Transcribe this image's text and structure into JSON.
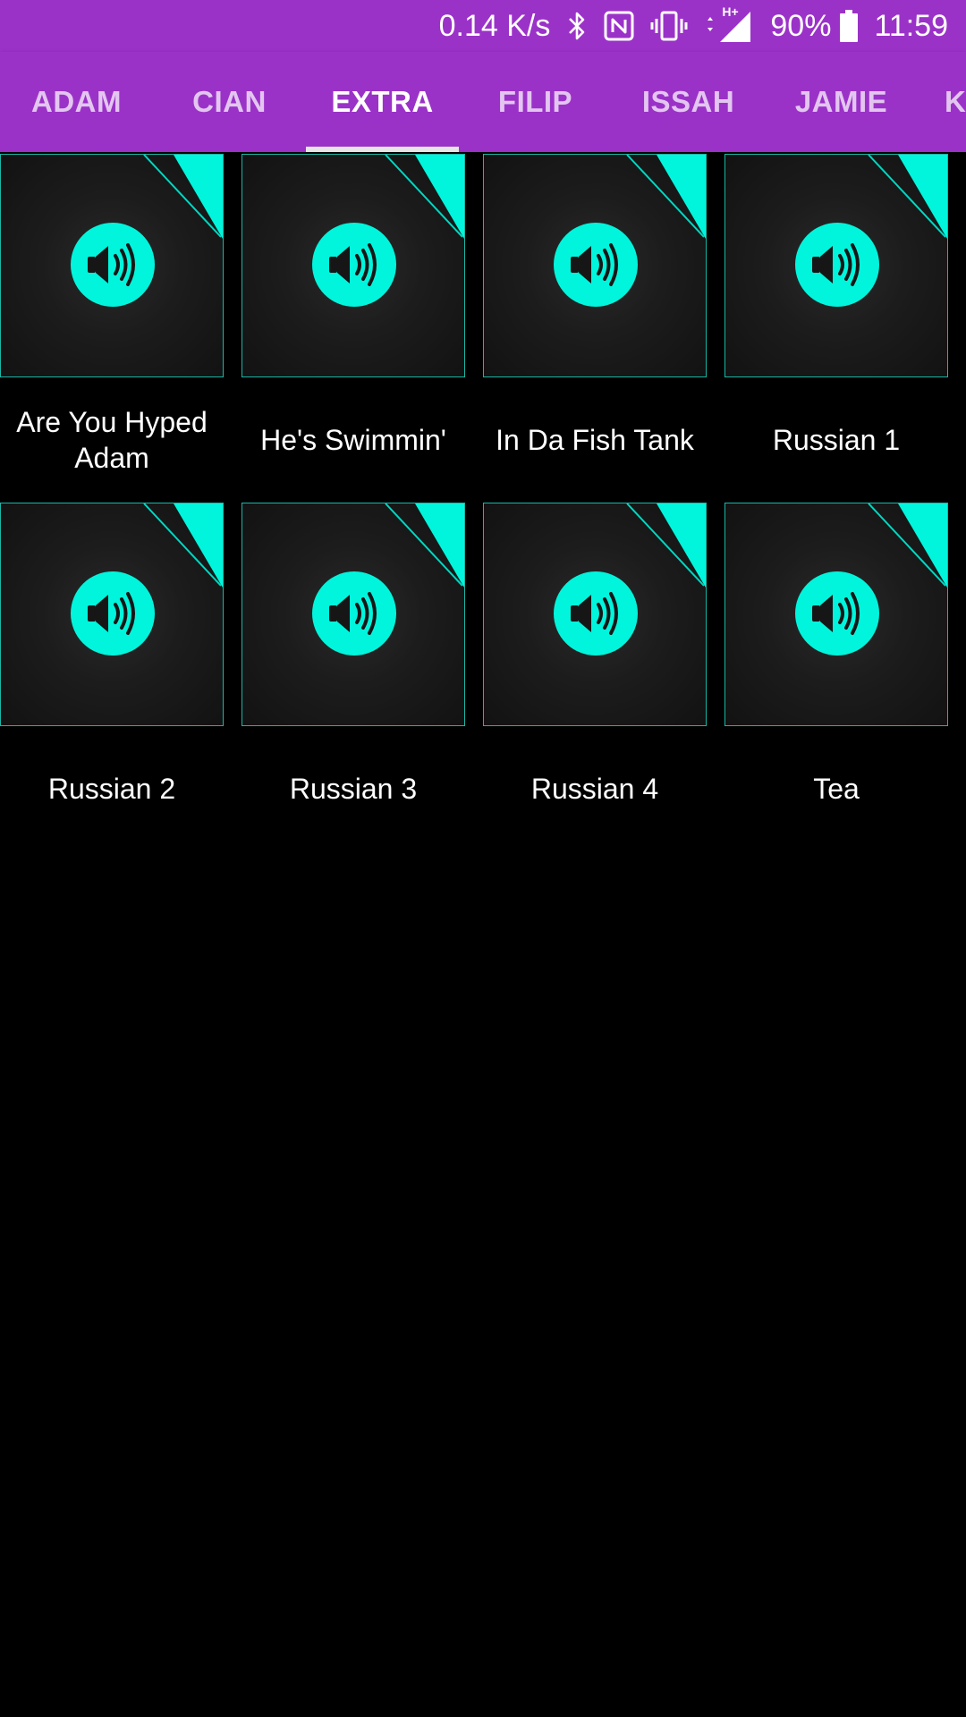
{
  "status_bar": {
    "net_speed": "0.14 K/s",
    "battery": "90%",
    "time": "11:59",
    "icons": [
      "bluetooth-icon",
      "nfc-icon",
      "vibrate-icon",
      "data-arrows-icon",
      "signal-icon",
      "battery-icon"
    ],
    "network_type": "H+"
  },
  "colors": {
    "primary": "#9b32c8",
    "accent": "#00f5dc",
    "tile_border": "#19b7a6",
    "background": "#000000"
  },
  "tabs": [
    {
      "label": "ADAM",
      "active": false
    },
    {
      "label": "CIAN",
      "active": false
    },
    {
      "label": "EXTRA",
      "active": true
    },
    {
      "label": "FILIP",
      "active": false
    },
    {
      "label": "ISSAH",
      "active": false
    },
    {
      "label": "JAMIE",
      "active": false
    },
    {
      "label": "KA",
      "active": false
    }
  ],
  "sounds": [
    {
      "label": "Are You Hyped Adam",
      "icon": "speaker-icon"
    },
    {
      "label": "He's Swimmin'",
      "icon": "speaker-icon"
    },
    {
      "label": "In Da Fish Tank",
      "icon": "speaker-icon"
    },
    {
      "label": "Russian 1",
      "icon": "speaker-icon"
    },
    {
      "label": "Russian 2",
      "icon": "speaker-icon"
    },
    {
      "label": "Russian 3",
      "icon": "speaker-icon"
    },
    {
      "label": "Russian 4",
      "icon": "speaker-icon"
    },
    {
      "label": "Tea",
      "icon": "speaker-icon"
    }
  ]
}
